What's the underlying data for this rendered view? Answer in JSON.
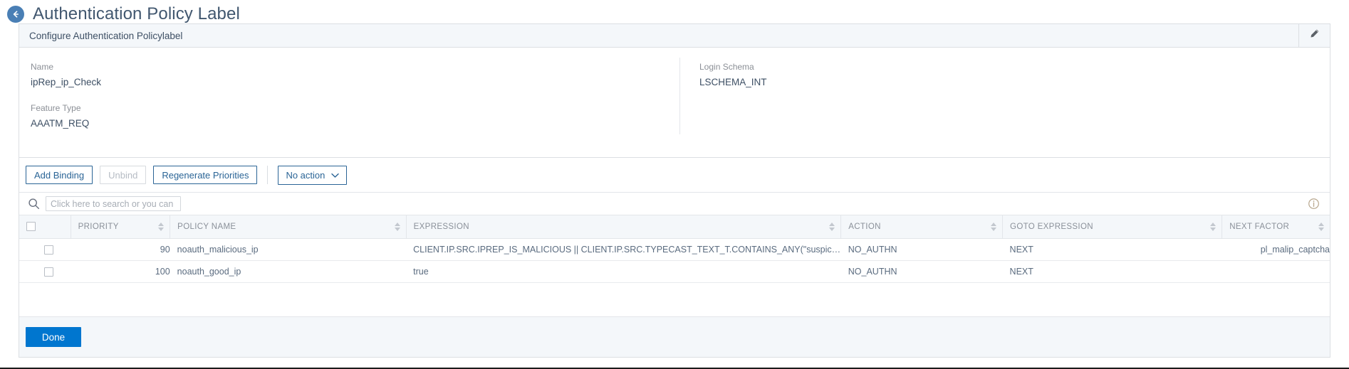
{
  "header": {
    "back_icon": "back-arrow-icon",
    "title": "Authentication Policy Label"
  },
  "card": {
    "title": "Configure Authentication Policylabel",
    "edit_icon": "pencil-icon"
  },
  "details": {
    "fields": [
      {
        "label": "Name",
        "value": "ipRep_ip_Check"
      },
      {
        "label": "Login Schema",
        "value": "LSCHEMA_INT"
      },
      {
        "label": "Feature Type",
        "value": "AAATM_REQ"
      }
    ]
  },
  "toolbar": {
    "add_binding": "Add Binding",
    "unbind": "Unbind",
    "regenerate": "Regenerate Priorities",
    "action_select": "No action",
    "chevron_icon": "chevron-down-icon"
  },
  "search": {
    "icon": "search-icon",
    "placeholder": "Click here to search or you can enter the key:value format",
    "value": "",
    "info_icon": "info-icon"
  },
  "table": {
    "columns": [
      "PRIORITY",
      "POLICY NAME",
      "EXPRESSION",
      "ACTION",
      "GOTO EXPRESSION",
      "NEXT FACTOR"
    ],
    "rows": [
      {
        "priority": "90",
        "policy_name": "noauth_malicious_ip",
        "expression": "CLIENT.IP.SRC.IPREP_IS_MALICIOUS || CLIENT.IP.SRC.TYPECAST_TEXT_T.CONTAINS_ANY(\"suspicious_ips\")",
        "action": "NO_AUTHN",
        "goto_expression": "NEXT",
        "next_factor": "pl_malip_captcha"
      },
      {
        "priority": "100",
        "policy_name": "noauth_good_ip",
        "expression": "true",
        "action": "NO_AUTHN",
        "goto_expression": "NEXT",
        "next_factor": ""
      }
    ]
  },
  "footer": {
    "done": "Done"
  },
  "colors": {
    "accent_blue": "#0076cf",
    "link_blue": "#2a6496",
    "header_bg": "#f4f7fa",
    "title_text": "#41576f"
  }
}
